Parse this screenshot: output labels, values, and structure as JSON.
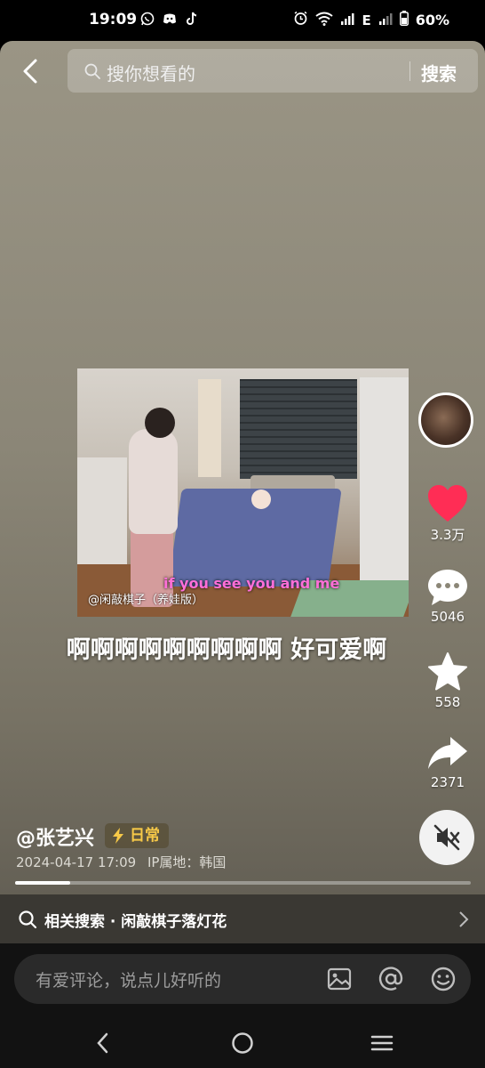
{
  "status_bar": {
    "time": "19:09",
    "battery": "60%",
    "network_label": "E",
    "app_icons": [
      "whatsapp-icon",
      "discord-icon",
      "tiktok-icon"
    ],
    "system_icons": [
      "alarm-icon",
      "wifi-icon",
      "signal-icon",
      "signal-icon",
      "battery-icon"
    ]
  },
  "search": {
    "placeholder": "搜你想看的",
    "button_label": "搜索"
  },
  "video": {
    "watermark": "@闲敲棋子（养娃版）",
    "subtitle": "if you see you and me",
    "caption": "啊啊啊啊啊啊啊啊啊 好可爱啊",
    "progress": 0.12
  },
  "actions": {
    "likes": "3.3万",
    "comments": "5046",
    "favorites": "558",
    "shares": "2371",
    "like_color": "#ff2d55"
  },
  "post": {
    "author": "@张艺兴",
    "tag": "日常",
    "tag_color": "#f7c948",
    "date": "2024-04-17 17:09",
    "ip_location": "IP属地：韩国"
  },
  "related_search": {
    "label": "相关搜索 · 闲敲棋子落灯花"
  },
  "comment_bar": {
    "placeholder": "有爱评论，说点儿好听的"
  }
}
